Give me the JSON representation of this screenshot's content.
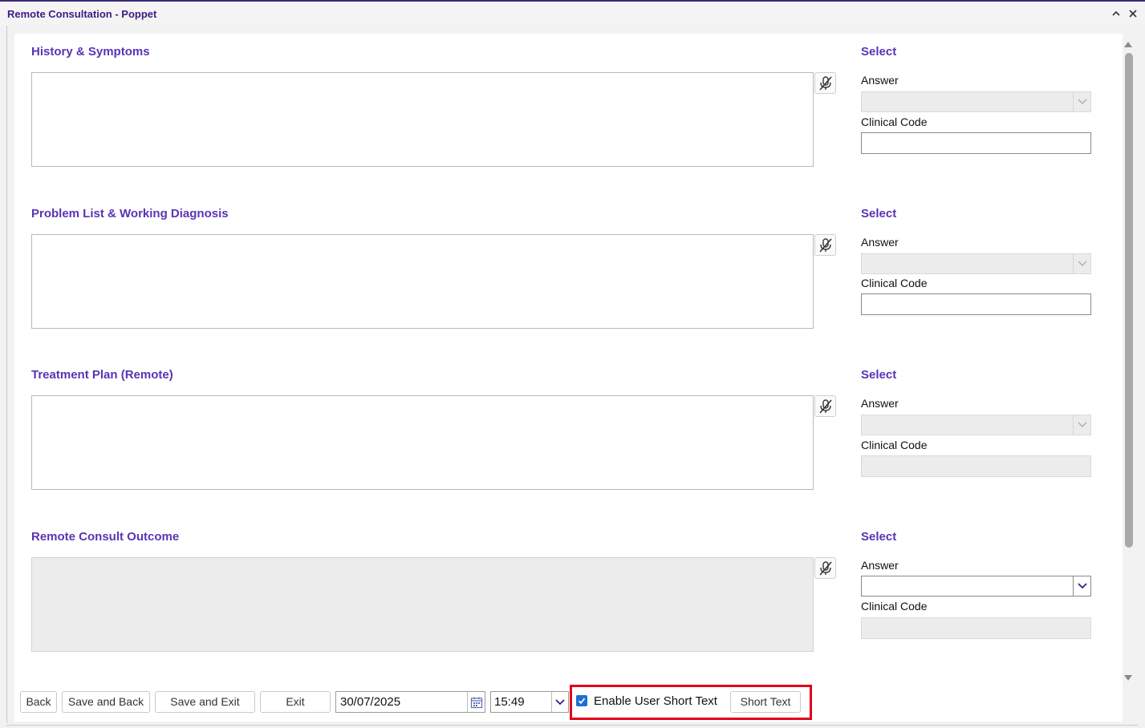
{
  "window": {
    "title": "Remote Consultation - Poppet",
    "controls": {
      "collapse_icon": "chevron-up-icon",
      "close_icon": "close-icon"
    }
  },
  "sections": [
    {
      "title": "History & Symptoms",
      "select_title": "Select",
      "answer_label": "Answer",
      "answer_value": "",
      "clinical_code_label": "Clinical Code",
      "clinical_code_value": "",
      "answer_enabled": false,
      "clinical_code_enabled": true,
      "text_enabled": true
    },
    {
      "title": "Problem List & Working Diagnosis",
      "select_title": "Select",
      "answer_label": "Answer",
      "answer_value": "",
      "clinical_code_label": "Clinical Code",
      "clinical_code_value": "",
      "answer_enabled": false,
      "clinical_code_enabled": true,
      "text_enabled": true
    },
    {
      "title": "Treatment Plan (Remote)",
      "select_title": "Select",
      "answer_label": "Answer",
      "answer_value": "",
      "clinical_code_label": "Clinical Code",
      "clinical_code_value": "",
      "answer_enabled": false,
      "clinical_code_enabled": false,
      "text_enabled": true
    },
    {
      "title": "Remote Consult Outcome",
      "select_title": "Select",
      "answer_label": "Answer",
      "answer_value": "",
      "clinical_code_label": "Clinical Code",
      "clinical_code_value": "",
      "answer_enabled": true,
      "clinical_code_enabled": false,
      "text_enabled": false
    }
  ],
  "footer": {
    "back_label": "Back",
    "save_back_label": "Save and Back",
    "save_exit_label": "Save and Exit",
    "exit_label": "Exit",
    "date_value": "30/07/2025",
    "time_value": "15:49",
    "enable_short_text_label": "Enable User Short Text",
    "enable_short_text_checked": true,
    "short_text_label": "Short Text"
  },
  "colors": {
    "accent": "#5b33b5",
    "title": "#3d1c84",
    "highlight": "#e0001a",
    "checkbox": "#1f6fd1"
  }
}
